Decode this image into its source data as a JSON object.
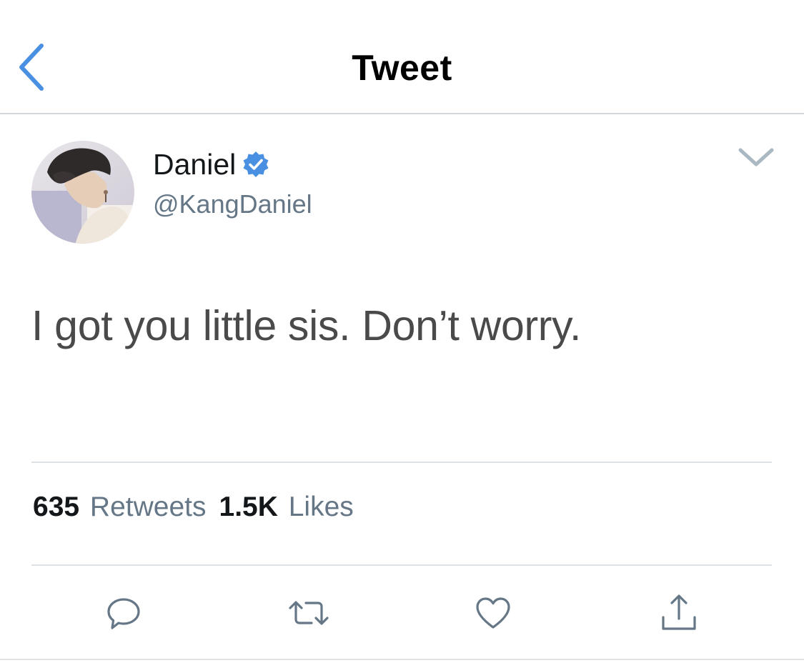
{
  "nav": {
    "title": "Tweet",
    "back_icon": "chevron-left-icon"
  },
  "colors": {
    "accent": "#4a90e2",
    "text": "#14171a",
    "secondary_text": "#657786",
    "divider": "#dfe2e5"
  },
  "tweet": {
    "author": {
      "display_name": "Daniel",
      "handle": "@KangDaniel",
      "verified": true
    },
    "text": "I got you little sis. Don’t worry.",
    "stats": {
      "retweets_count": "635",
      "retweets_label": "Retweets",
      "likes_count": "1.5K",
      "likes_label": "Likes"
    },
    "actions": [
      {
        "name": "reply",
        "icon": "speech-bubble-icon"
      },
      {
        "name": "retweet",
        "icon": "retweet-arrows-icon"
      },
      {
        "name": "like",
        "icon": "heart-icon"
      },
      {
        "name": "share",
        "icon": "share-upload-icon"
      }
    ]
  }
}
